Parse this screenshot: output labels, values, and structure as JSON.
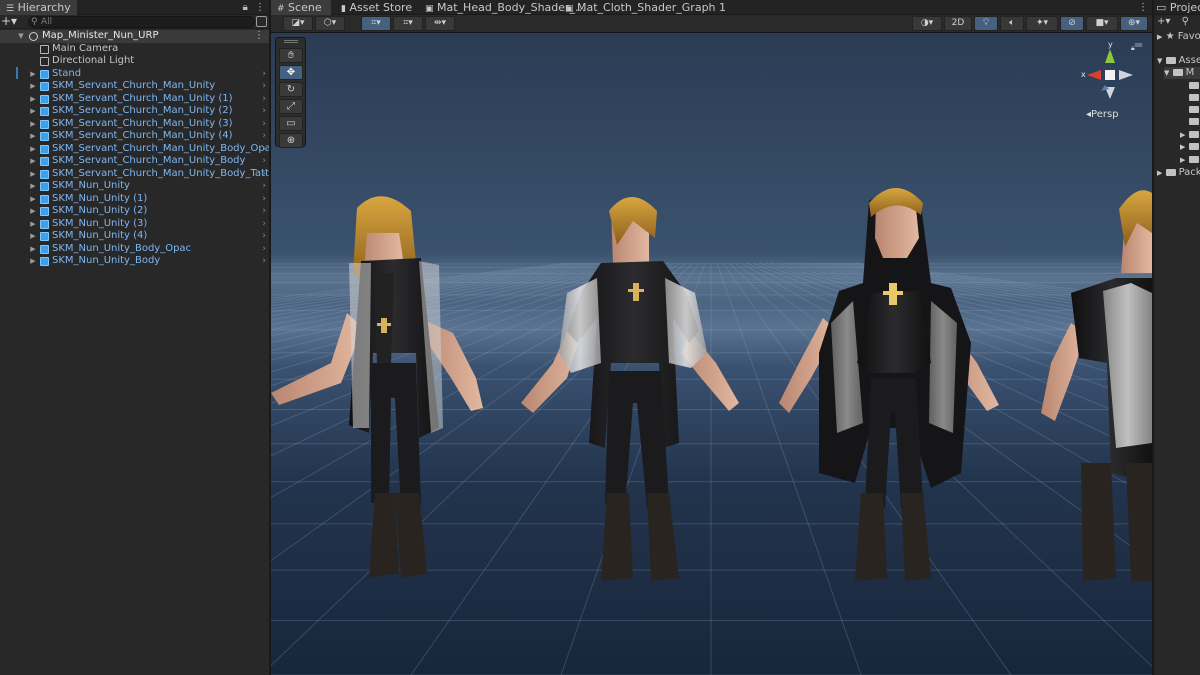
{
  "hierarchy": {
    "tab_label": "Hierarchy",
    "search_placeholder": "All",
    "scene_name": "Map_Minister_Nun_URP",
    "items": [
      {
        "label": "Main Camera",
        "kind": "object"
      },
      {
        "label": "Directional Light",
        "kind": "object"
      },
      {
        "label": "Stand",
        "kind": "prefab"
      },
      {
        "label": "SKM_Servant_Church_Man_Unity",
        "kind": "prefab"
      },
      {
        "label": "SKM_Servant_Church_Man_Unity (1)",
        "kind": "prefab"
      },
      {
        "label": "SKM_Servant_Church_Man_Unity (2)",
        "kind": "prefab"
      },
      {
        "label": "SKM_Servant_Church_Man_Unity (3)",
        "kind": "prefab"
      },
      {
        "label": "SKM_Servant_Church_Man_Unity (4)",
        "kind": "prefab"
      },
      {
        "label": "SKM_Servant_Church_Man_Unity_Body_Opac",
        "kind": "prefab"
      },
      {
        "label": "SKM_Servant_Church_Man_Unity_Body",
        "kind": "prefab"
      },
      {
        "label": "SKM_Servant_Church_Man_Unity_Body_Tatto",
        "kind": "prefab"
      },
      {
        "label": "SKM_Nun_Unity",
        "kind": "prefab"
      },
      {
        "label": "SKM_Nun_Unity (1)",
        "kind": "prefab"
      },
      {
        "label": "SKM_Nun_Unity (2)",
        "kind": "prefab"
      },
      {
        "label": "SKM_Nun_Unity (3)",
        "kind": "prefab"
      },
      {
        "label": "SKM_Nun_Unity (4)",
        "kind": "prefab"
      },
      {
        "label": "SKM_Nun_Unity_Body_Opac",
        "kind": "prefab"
      },
      {
        "label": "SKM_Nun_Unity_Body",
        "kind": "prefab"
      }
    ]
  },
  "scene_tabs": [
    {
      "label": "Scene",
      "icon": "grid-icon",
      "active": true
    },
    {
      "label": "Asset Store",
      "icon": "bag-icon",
      "active": false
    },
    {
      "label": "Mat_Head_Body_Shader_...",
      "icon": "shader-graph-icon",
      "active": false
    },
    {
      "label": "Mat_Cloth_Shader_Graph 1",
      "icon": "shader-graph-icon",
      "active": false
    }
  ],
  "scene_toolbar": {
    "mode_2d_label": "2D",
    "left_tools": [
      "draw-mode-icon",
      "render-mode-icon",
      "grid-snap-icon",
      "increment-snap-icon",
      "orientation-icon"
    ],
    "right_tools": [
      "shading-sphere-icon",
      "2d-toggle",
      "lighting-icon",
      "audio-icon",
      "effects-icon",
      "hidden-objects-icon",
      "camera-icon",
      "gizmos-icon"
    ]
  },
  "tool_palette": [
    "hand-tool-icon",
    "move-tool-icon",
    "rotate-tool-icon",
    "scale-tool-icon",
    "rect-tool-icon",
    "transform-tool-icon"
  ],
  "gizmo": {
    "x_label": "x",
    "y_label": "y",
    "projection_label": "Persp"
  },
  "project": {
    "tab_label": "Project",
    "favorites_label": "Favo",
    "assets_label": "Asse",
    "selected_folder_label": "M",
    "packages_label": "Pack"
  },
  "colors": {
    "accent_blue": "#46607f",
    "prefab_text": "#7eb6f2",
    "gizmo_x": "#d8412f",
    "gizmo_y": "#8cc63e",
    "hair_gold": "#b8862a",
    "outfit_black": "#1c1c1e",
    "outfit_white": "#d6d6d6"
  }
}
